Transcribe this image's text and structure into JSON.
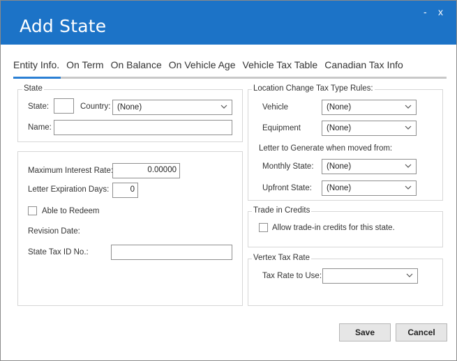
{
  "window": {
    "title": "Add State",
    "minimize": "-",
    "close": "x"
  },
  "tabs": [
    "Entity Info.",
    "On Term",
    "On Balance",
    "On Vehicle Age",
    "Vehicle Tax Table",
    "Canadian Tax Info"
  ],
  "state_group": {
    "legend": "State",
    "state_label": "State:",
    "state_value": "",
    "country_label": "Country:",
    "country_value": "(None)",
    "name_label": "Name:",
    "name_value": ""
  },
  "details_group": {
    "max_interest_label": "Maximum Interest Rate:",
    "max_interest_value": "0.00000",
    "letter_exp_label": "Letter Expiration Days:",
    "letter_exp_value": "0",
    "able_redeem_label": "Able to Redeem",
    "revision_date_label": "Revision Date:",
    "state_tax_id_label": "State Tax ID No.:",
    "state_tax_id_value": ""
  },
  "location_group": {
    "legend": "Location Change Tax Type Rules:",
    "vehicle_label": "Vehicle",
    "vehicle_value": "(None)",
    "equipment_label": "Equipment",
    "equipment_value": "(None)",
    "letter_label": "Letter to Generate when moved from:",
    "monthly_label": "Monthly State:",
    "monthly_value": "(None)",
    "upfront_label": "Upfront State:",
    "upfront_value": "(None)"
  },
  "trade_group": {
    "legend": "Trade in Credits",
    "allow_label": "Allow trade-in credits for this state."
  },
  "vertex_group": {
    "legend": "Vertex Tax Rate",
    "rate_label": "Tax Rate to Use:",
    "rate_value": ""
  },
  "buttons": {
    "save": "Save",
    "cancel": "Cancel"
  }
}
